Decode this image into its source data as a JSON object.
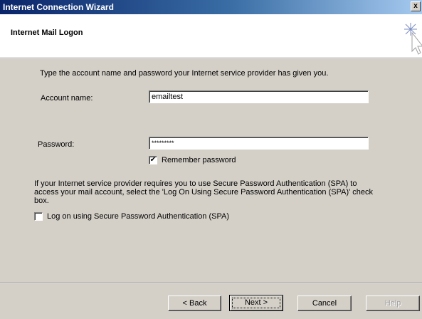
{
  "window": {
    "title": "Internet Connection Wizard",
    "close_glyph": "x"
  },
  "header": {
    "heading": "Internet Mail Logon"
  },
  "form": {
    "intro": "Type the account name and password your Internet service provider has given you.",
    "account_label": "Account name:",
    "account_value": "emailtest",
    "password_label": "Password:",
    "password_value": "*********",
    "remember_checked": true,
    "remember_label": "Remember password",
    "spa_info": "If your Internet service provider requires you to use Secure Password Authentication (SPA) to access your mail account, select the 'Log On Using Secure Password Authentication (SPA)' check box.",
    "spa_checked": false,
    "spa_label": "Log on using Secure Password Authentication (SPA)"
  },
  "buttons": {
    "back": "< Back",
    "next": "Next >",
    "cancel": "Cancel",
    "help": "Help"
  },
  "icons": {
    "wizard": "wizard-sparkle-cursor-icon",
    "check": "✔"
  },
  "colors": {
    "title_start": "#0a246a",
    "title_end": "#a6caf0",
    "dialog_bg": "#d4d0c8"
  }
}
